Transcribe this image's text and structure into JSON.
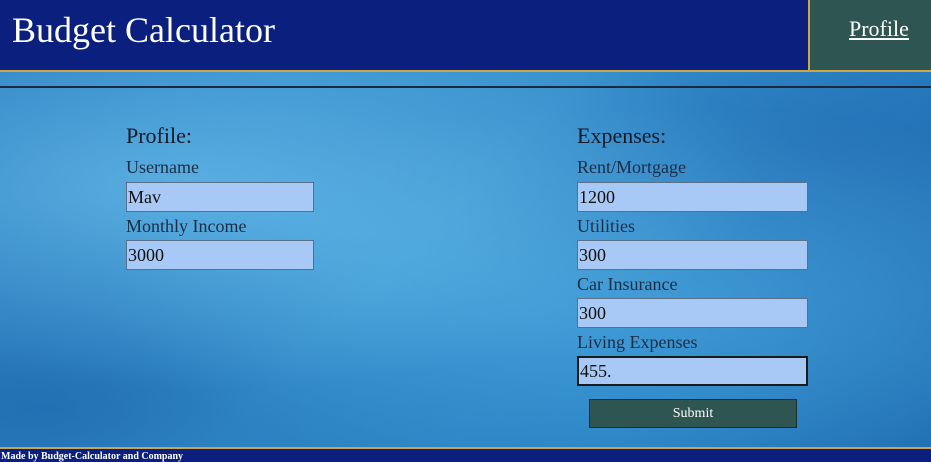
{
  "header": {
    "title": "Budget Calculator",
    "profile_link": "Profile"
  },
  "profile": {
    "heading": "Profile:",
    "username_label": "Username",
    "username_value": "Mav",
    "income_label": "Monthly Income",
    "income_value": "3000"
  },
  "expenses": {
    "heading": "Expenses:",
    "rent_label": "Rent/Mortgage",
    "rent_value": "1200",
    "utilities_label": "Utilities",
    "utilities_value": "300",
    "insurance_label": "Car Insurance",
    "insurance_value": "300",
    "living_label": "Living Expenses",
    "living_value": "455."
  },
  "submit_label": "Submit",
  "footer": {
    "text": "Made by Budget-Calculator and Company"
  },
  "colors": {
    "header_bg": "#0b1f7e",
    "profile_box_bg": "#2f5552",
    "accent_border": "#c9a64a",
    "input_bg": "#a8c8f5",
    "button_bg": "#2f5552"
  }
}
